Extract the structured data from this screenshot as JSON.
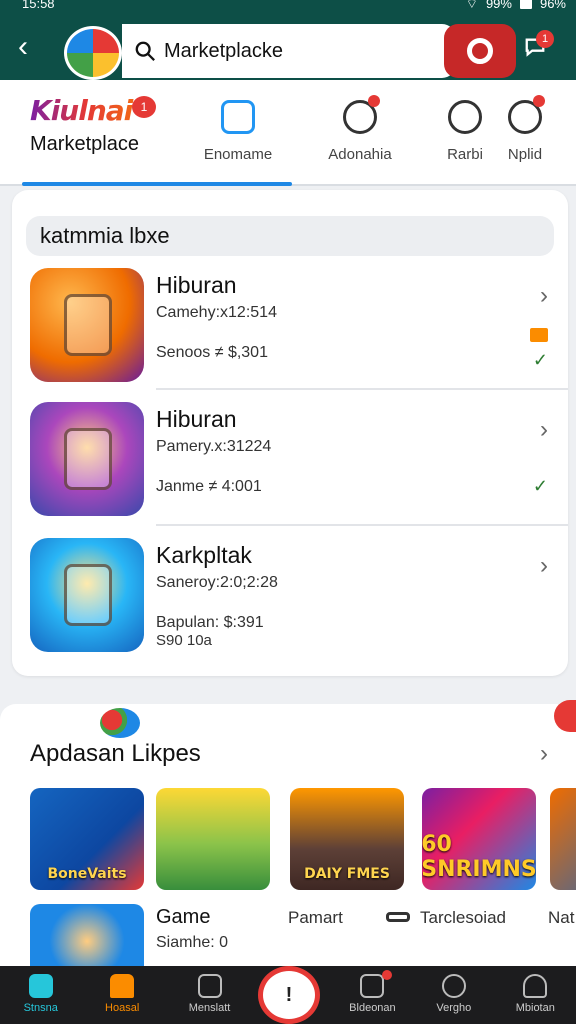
{
  "status_bar": {
    "time": "15:58",
    "wifi": "99%",
    "battery": "96%"
  },
  "header": {
    "search_value": "Marketplacke",
    "notif_count": "1"
  },
  "tabs": {
    "brand_name": "Kiulnai",
    "brand_badge": "1",
    "brand_sub": "Marketplace",
    "items": [
      {
        "label": "Enomame"
      },
      {
        "label": "Adonahia"
      },
      {
        "label": "Rarbi"
      },
      {
        "label": "Nplid"
      }
    ]
  },
  "list": {
    "section_title": "katmmia lbxe",
    "items": [
      {
        "title": "Hiburan",
        "line1": "Camehy:x12:514",
        "line2": "Senoos ≠ $,301",
        "line3": ""
      },
      {
        "title": "Hiburan",
        "line1": "Pamery.x:31224",
        "line2": "Janme ≠ 4:001",
        "line3": ""
      },
      {
        "title": "Karkpltak",
        "line1": "Saneroy:2:0;2:28",
        "line2": "Bapulan: $:391",
        "line3": "S90 10a"
      }
    ]
  },
  "panel2": {
    "title": "Apdasan Likpes",
    "games": [
      {
        "label": "BoneVaits"
      },
      {
        "label": ""
      },
      {
        "label": "DAIY FMES"
      },
      {
        "label": "60 SNRIMNS"
      },
      {
        "label": ""
      }
    ],
    "row_game": "Game",
    "row_sub": "Siamhe: 0",
    "row_t1": "Pamart",
    "row_t2": "Tarclesoiad",
    "row_t3": "Nat"
  },
  "bottom_nav": [
    {
      "label": "Stnsna"
    },
    {
      "label": "Hoasal"
    },
    {
      "label": "Menslatt"
    },
    {
      "label": ""
    },
    {
      "label": "Bldeonan"
    },
    {
      "label": "Vergho"
    },
    {
      "label": "Mbiotan"
    }
  ],
  "fab_label": "!",
  "colors": {
    "header": "#0d4f47",
    "accent": "#1e88e5",
    "danger": "#e53935",
    "nav_bg": "#1c1c1e"
  }
}
